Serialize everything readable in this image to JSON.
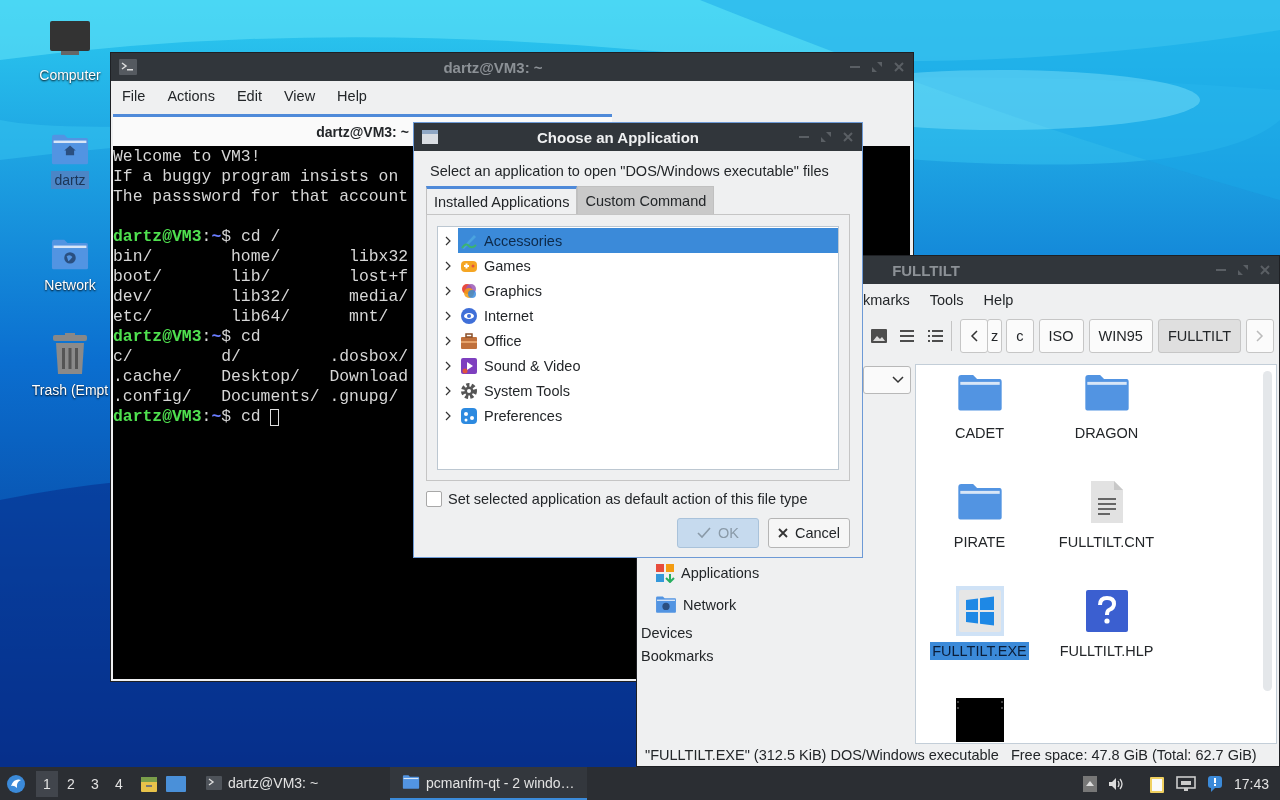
{
  "desktop_icons": [
    {
      "label": "Computer",
      "kind": "computer",
      "selected": false
    },
    {
      "label": "dartz",
      "kind": "home",
      "selected": true
    },
    {
      "label": "Network",
      "kind": "network",
      "selected": false
    },
    {
      "label": "Trash (Empt",
      "kind": "trash",
      "selected": false
    }
  ],
  "terminal": {
    "title": "dartz@VM3: ~",
    "menu": [
      "File",
      "Actions",
      "Edit",
      "View",
      "Help"
    ],
    "tab": "dartz@VM3: ~",
    "lines": [
      {
        "kind": "text",
        "text": "Welcome to VM3!"
      },
      {
        "kind": "text",
        "text": "If a buggy program insists on"
      },
      {
        "kind": "text",
        "text": "The passsword for that account"
      },
      {
        "kind": "blank"
      },
      {
        "kind": "prompt",
        "user": "dartz@VM3",
        "sep": ":",
        "path": "~",
        "command": "$ cd /",
        "cursor": false
      },
      {
        "kind": "text",
        "text": "bin/        home/       libx32"
      },
      {
        "kind": "text",
        "text": "boot/       lib/        lost+f"
      },
      {
        "kind": "text",
        "text": "dev/        lib32/      media/"
      },
      {
        "kind": "text",
        "text": "etc/        lib64/      mnt/"
      },
      {
        "kind": "prompt",
        "user": "dartz@VM3",
        "sep": ":",
        "path": "~",
        "command": "$ cd",
        "cursor": false
      },
      {
        "kind": "text",
        "text": "c/         d/         .dosbox/"
      },
      {
        "kind": "text",
        "text": ".cache/    Desktop/   Download"
      },
      {
        "kind": "text",
        "text": ".config/   Documents/ .gnupg/"
      },
      {
        "kind": "prompt",
        "user": "dartz@VM3",
        "sep": ":",
        "path": "~",
        "command": "$ cd ",
        "cursor": true
      }
    ]
  },
  "file_manager": {
    "title": "FULLTILT",
    "menu": [
      "kmarks",
      "Tools",
      "Help"
    ],
    "path": [
      {
        "label": "z",
        "selected": false
      },
      {
        "label": "c",
        "selected": false
      },
      {
        "label": "ISO",
        "selected": false
      },
      {
        "label": "WIN95",
        "selected": false
      },
      {
        "label": "FULLTILT",
        "selected": true
      }
    ],
    "places": [
      {
        "label": "Applications",
        "kind": "applications"
      },
      {
        "label": "Network",
        "kind": "network"
      }
    ],
    "sections": [
      "Devices",
      "Bookmarks"
    ],
    "files": [
      {
        "name": "CADET",
        "kind": "folder",
        "selected": false
      },
      {
        "name": "DRAGON",
        "kind": "folder",
        "selected": false
      },
      {
        "name": "PIRATE",
        "kind": "folder",
        "selected": false
      },
      {
        "name": "FULLTILT.CNT",
        "kind": "text",
        "selected": false
      },
      {
        "name": "FULLTILT.EXE",
        "kind": "exe",
        "selected": true
      },
      {
        "name": "FULLTILT.HLP",
        "kind": "help",
        "selected": false
      },
      {
        "kind": "video",
        "selected": false
      }
    ],
    "status": "\"FULLTILT.EXE\" (312.5 KiB) DOS/Windows executable",
    "free_space": "Free space: 47.8 GiB (Total: 62.7 GiB)"
  },
  "dialog": {
    "title": "Choose an Application",
    "prompt": "Select an application to open \"DOS/Windows executable\" files",
    "tabs": [
      {
        "label": "Installed Applications",
        "selected": true
      },
      {
        "label": "Custom Command",
        "selected": false
      }
    ],
    "categories": [
      {
        "label": "Accessories",
        "kind": "accessories",
        "selected": true,
        "expanded": false
      },
      {
        "label": "Games",
        "kind": "games",
        "selected": false,
        "expanded": false
      },
      {
        "label": "Graphics",
        "kind": "graphics",
        "selected": false,
        "expanded": false
      },
      {
        "label": "Internet",
        "kind": "internet",
        "selected": false,
        "expanded": false
      },
      {
        "label": "Office",
        "kind": "office",
        "selected": false,
        "expanded": false
      },
      {
        "label": "Sound & Video",
        "kind": "sound_video",
        "selected": false,
        "expanded": false
      },
      {
        "label": "System Tools",
        "kind": "system",
        "selected": false,
        "expanded": false
      },
      {
        "label": "Preferences",
        "kind": "preferences",
        "selected": false,
        "expanded": false
      }
    ],
    "default_checkbox": {
      "label": "Set selected application as default action of this file type",
      "checked": false
    },
    "buttons": [
      {
        "label": "OK",
        "kind": "ok",
        "disabled": true
      },
      {
        "label": "Cancel",
        "kind": "cancel",
        "disabled": false
      }
    ]
  },
  "taskbar": {
    "workspaces": [
      {
        "label": "1",
        "selected": true
      },
      {
        "label": "2",
        "selected": false
      },
      {
        "label": "3",
        "selected": false
      },
      {
        "label": "4",
        "selected": false
      }
    ],
    "tasks": [
      {
        "label": "dartz@VM3: ~",
        "kind": "terminal",
        "active": false
      },
      {
        "label": "pcmanfm-qt - 2 windo…",
        "kind": "folder",
        "active": true
      }
    ],
    "clock": "17:43"
  }
}
